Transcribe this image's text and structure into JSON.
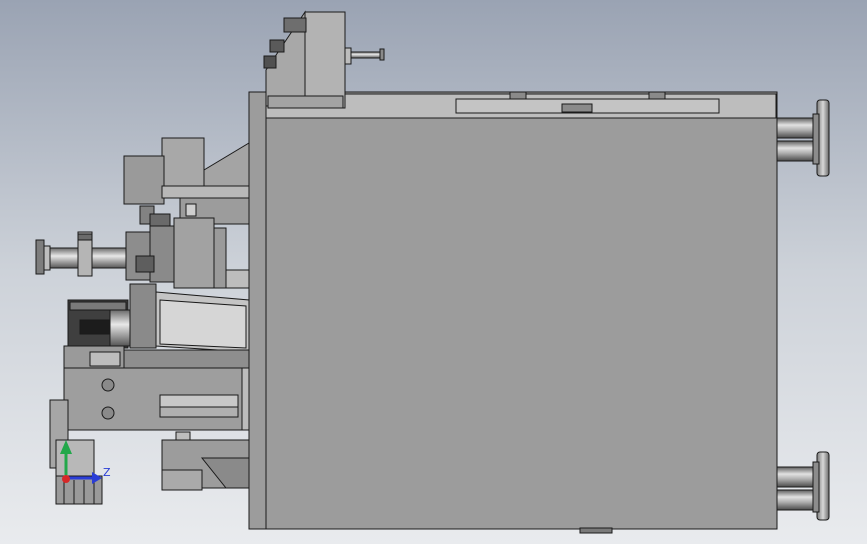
{
  "viewport": {
    "background_top": "#9aa3b3",
    "background_bottom": "#e9ebee"
  },
  "model": {
    "body_color": "#9c9c9c",
    "edge_color": "#1a1a1a",
    "highlight_color": "#c8c8c8"
  },
  "triad": {
    "z_label": "Z",
    "y_axis_color": "#22a84a",
    "z_axis_color": "#2a3dd6",
    "x_axis_color": "#d62828"
  }
}
